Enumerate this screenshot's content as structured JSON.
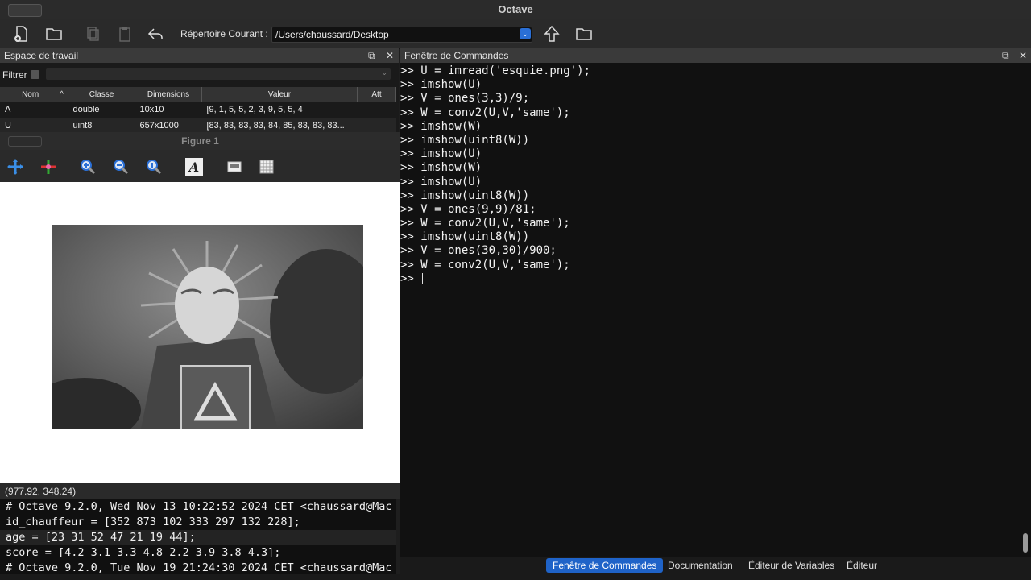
{
  "window": {
    "title": "Octave"
  },
  "toolbar": {
    "current_dir_label": "Répertoire Courant :",
    "current_dir_value": "/Users/chaussard/Desktop"
  },
  "workspace": {
    "title": "Espace de travail",
    "filter_label": "Filtrer",
    "columns": [
      "Nom",
      "Classe",
      "Dimensions",
      "Valeur",
      "Att"
    ],
    "rows": [
      {
        "name": "A",
        "class": "double",
        "dims": "10x10",
        "value": "[9, 1, 5, 5, 2, 3, 9, 5, 5, 4"
      },
      {
        "name": "U",
        "class": "uint8",
        "dims": "657x1000",
        "value": "[83, 83, 83, 83, 84, 85, 83, 83, 83..."
      }
    ]
  },
  "figure": {
    "title": "Figure 1",
    "coords": "(977.92, 348.24)"
  },
  "history": {
    "lines": [
      "# Octave 9.2.0, Wed Nov 13 10:22:52 2024 CET <chaussard@Mac",
      "id_chauffeur = [352 873 102 333 297 132 228];",
      "age = [23 31 52 47 21 19 44];",
      "score = [4.2 3.1 3.3 4.8 2.2 3.9 3.8 4.3];",
      "# Octave 9.2.0, Tue Nov 19 21:24:30 2024 CET <chaussard@Mac"
    ]
  },
  "command_window": {
    "title": "Fenêtre de Commandes",
    "lines": [
      ">> U = imread('esquie.png');",
      ">> imshow(U)",
      ">> V = ones(3,3)/9;",
      ">> W = conv2(U,V,'same');",
      ">> imshow(W)",
      ">> imshow(uint8(W))",
      ">> imshow(U)",
      ">> imshow(W)",
      ">> imshow(U)",
      ">> imshow(uint8(W))",
      ">> V = ones(9,9)/81;",
      ">> W = conv2(U,V,'same');",
      ">> imshow(uint8(W))",
      ">> V = ones(30,30)/900;",
      ">> W = conv2(U,V,'same');"
    ],
    "prompt": ">> "
  },
  "tabs": [
    "Fenêtre de Commandes",
    "Documentation",
    "Éditeur de Variables",
    "Éditeur"
  ]
}
